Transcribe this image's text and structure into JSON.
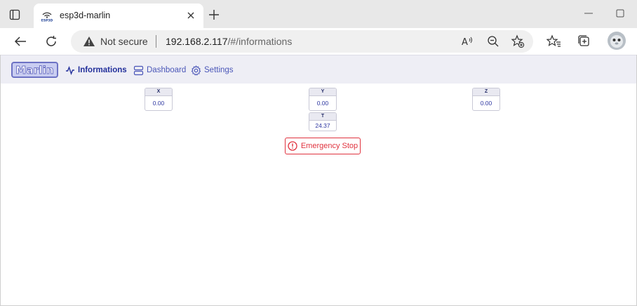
{
  "browser": {
    "tab": {
      "title": "esp3d-marlin"
    },
    "address": {
      "security_label": "Not secure",
      "url_host": "192.168.2.117",
      "url_path": "/#/informations"
    },
    "icons": [
      "tab-actions-icon",
      "favicon-icon",
      "close-icon",
      "plus-icon",
      "minimize-icon",
      "maximize-icon",
      "back-arrow-icon",
      "refresh-icon",
      "warning-icon",
      "read-aloud-icon",
      "zoom-out-icon",
      "add-favorite-icon",
      "favorites-icon",
      "collections-icon",
      "profile-avatar"
    ]
  },
  "app": {
    "logo_text": "Marlin",
    "nav": [
      {
        "label": "Informations",
        "icon": "activity-icon",
        "active": true
      },
      {
        "label": "Dashboard",
        "icon": "server-icon",
        "active": false
      },
      {
        "label": "Settings",
        "icon": "gear-icon",
        "active": false
      }
    ],
    "positions": [
      {
        "label": "X",
        "value": "0.00"
      },
      {
        "label": "Y",
        "value": "0.00"
      },
      {
        "label": "Z",
        "value": "0.00"
      },
      {
        "label": "T",
        "value": "24.37"
      }
    ],
    "emergency_stop_label": "Emergency Stop",
    "accent_color": "#4a56b8",
    "danger_color": "#e0323e"
  }
}
